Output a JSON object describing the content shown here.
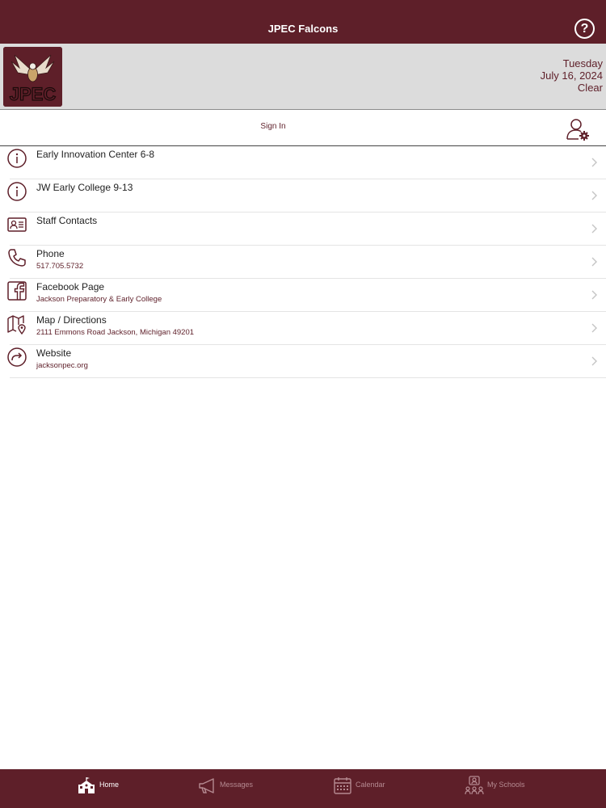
{
  "header": {
    "title": "JPEC Falcons",
    "help_glyph": "?"
  },
  "banner": {
    "logo_text": "JPEC",
    "day": "Tuesday",
    "date": "July 16, 2024",
    "clear_label": "Clear"
  },
  "signin": {
    "label": "Sign In",
    "icon": "user-settings-icon"
  },
  "list": [
    {
      "title": "Early Innovation Center 6-8",
      "subtitle": "",
      "icon": "info-icon"
    },
    {
      "title": "JW Early College 9-13",
      "subtitle": "",
      "icon": "info-icon"
    },
    {
      "title": "Staff Contacts",
      "subtitle": "",
      "icon": "contact-card-icon"
    },
    {
      "title": "Phone",
      "subtitle": "517.705.5732",
      "icon": "phone-icon"
    },
    {
      "title": "Facebook Page",
      "subtitle": "Jackson Preparatory & Early College",
      "icon": "facebook-icon"
    },
    {
      "title": "Map / Directions",
      "subtitle": "2111 Emmons Road Jackson, Michigan 49201",
      "icon": "map-icon"
    },
    {
      "title": "Website",
      "subtitle": "jacksonpec.org",
      "icon": "website-icon"
    }
  ],
  "tabs": [
    {
      "label": "Home",
      "icon": "school-house-icon",
      "active": true
    },
    {
      "label": "Messages",
      "icon": "megaphone-icon",
      "active": false
    },
    {
      "label": "Calendar",
      "icon": "calendar-icon",
      "active": false
    },
    {
      "label": "My Schools",
      "icon": "group-icon",
      "active": false
    }
  ],
  "colors": {
    "brand": "#5e1f29",
    "banner_bg": "#dcdcdc",
    "text": "#222222",
    "tab_dim": "#b58a91"
  }
}
